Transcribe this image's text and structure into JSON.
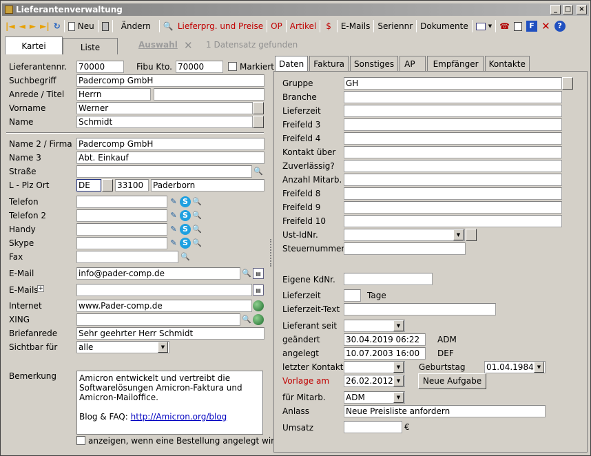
{
  "window": {
    "title": "Lieferantenverwaltung",
    "min": "_",
    "max": "□",
    "close": "×"
  },
  "toolbar": {
    "first": "|◄",
    "prev": "◄",
    "next": "►",
    "last": "►|",
    "refresh": "↻",
    "neu": "Neu",
    "andern": "Ändern",
    "lieferprg": "Lieferprg. und Preise",
    "op": "OP",
    "artikel": "Artikel",
    "dollar": "$",
    "emails": "E-Mails",
    "seriennr": "Seriennr",
    "dokumente": "Dokumente",
    "help": "?"
  },
  "tabs": {
    "kartei": "Kartei",
    "liste": "Liste",
    "auswahl": "Auswahl",
    "clear": "✕",
    "status": "1 Datensatz gefunden"
  },
  "left": {
    "lieferantennr_label": "Lieferantennr.",
    "lieferantennr": "70000",
    "fibu_label": "Fibu Kto.",
    "fibu": "70000",
    "markiert_label": "Markiert",
    "suchbegriff_label": "Suchbegriff",
    "suchbegriff": "Padercomp GmbH",
    "anrede_label": "Anrede / Titel",
    "anrede": "Herrn",
    "titel": "",
    "vorname_label": "Vorname",
    "vorname": "Werner",
    "name_label": "Name",
    "name": "Schmidt",
    "name2_label": "Name 2 / Firma",
    "name2": "Padercomp GmbH",
    "name3_label": "Name 3",
    "name3": "Abt. Einkauf",
    "strasse_label": "Straße",
    "strasse": "",
    "lplz_label": "L - Plz Ort",
    "land": "DE",
    "plz": "33100",
    "ort": "Paderborn",
    "telefon_label": "Telefon",
    "telefon2_label": "Telefon 2",
    "handy_label": "Handy",
    "skype_label": "Skype",
    "fax_label": "Fax",
    "email_label": "E-Mail",
    "email": "info@pader-comp.de",
    "emails_label": "E-Mails",
    "emails_plus": "+",
    "internet_label": "Internet",
    "internet": "www.Pader-comp.de",
    "xing_label": "XING",
    "briefanrede_label": "Briefanrede",
    "briefanrede": "Sehr geehrter Herr Schmidt",
    "sichtbar_label": "Sichtbar für",
    "sichtbar": "alle",
    "bemerkung_label": "Bemerkung",
    "bemerkung_line1": "Amicron entwickelt und vertreibt die",
    "bemerkung_line2": "Softwarelösungen Amicron-Faktura und",
    "bemerkung_line3": "Amicron-Mailoffice.",
    "bemerkung_blog": "Blog & FAQ: ",
    "bemerkung_link": "http://Amicron.org/blog",
    "anzeigen_label": "anzeigen, wenn eine Bestellung angelegt wird"
  },
  "right": {
    "tabs": [
      "Daten",
      "Faktura",
      "Sonstiges",
      "AP",
      "Empfänger",
      "Kontakte"
    ],
    "gruppe_label": "Gruppe",
    "gruppe": "GH",
    "branche_label": "Branche",
    "lieferzeit_label": "Lieferzeit",
    "freifeld3_label": "Freifeld 3",
    "freifeld4_label": "Freifeld 4",
    "kontakt_label": "Kontakt über",
    "zuverlaessig_label": "Zuverlässig?",
    "anzahl_label": "Anzahl Mitarb.",
    "freifeld8_label": "Freifeld 8",
    "freifeld9_label": "Freifeld 9",
    "freifeld10_label": "Freifeld 10",
    "ustid_label": "Ust-IdNr.",
    "steuer_label": "Steuernummer",
    "eigene_label": "Eigene KdNr.",
    "lieferzeit2_label": "Lieferzeit",
    "tage_label": "Tage",
    "lieferzeittext_label": "Lieferzeit-Text",
    "lieferantseit_label": "Lieferant seit",
    "geaendert_label": "geändert",
    "geaendert": "30.04.2019 06:22",
    "geaendert_user": "ADM",
    "angelegt_label": "angelegt",
    "angelegt": "10.07.2003 16:00",
    "angelegt_user": "DEF",
    "letzter_label": "letzter Kontakt",
    "geburtstag_label": "Geburtstag",
    "geburtstag": "01.04.1984",
    "vorlage_label": "Vorlage am",
    "vorlage": "26.02.2012",
    "neue_aufgabe": "Neue Aufgabe",
    "mitarb_label": "für Mitarb.",
    "mitarb": "ADM",
    "anlass_label": "Anlass",
    "anlass": "Neue Preisliste anfordern",
    "umsatz_label": "Umsatz",
    "umsatz_currency": "€"
  },
  "colors": {
    "accent_red": "#c00000",
    "link": "#0000c0",
    "window_bg": "#d4d0c8"
  }
}
